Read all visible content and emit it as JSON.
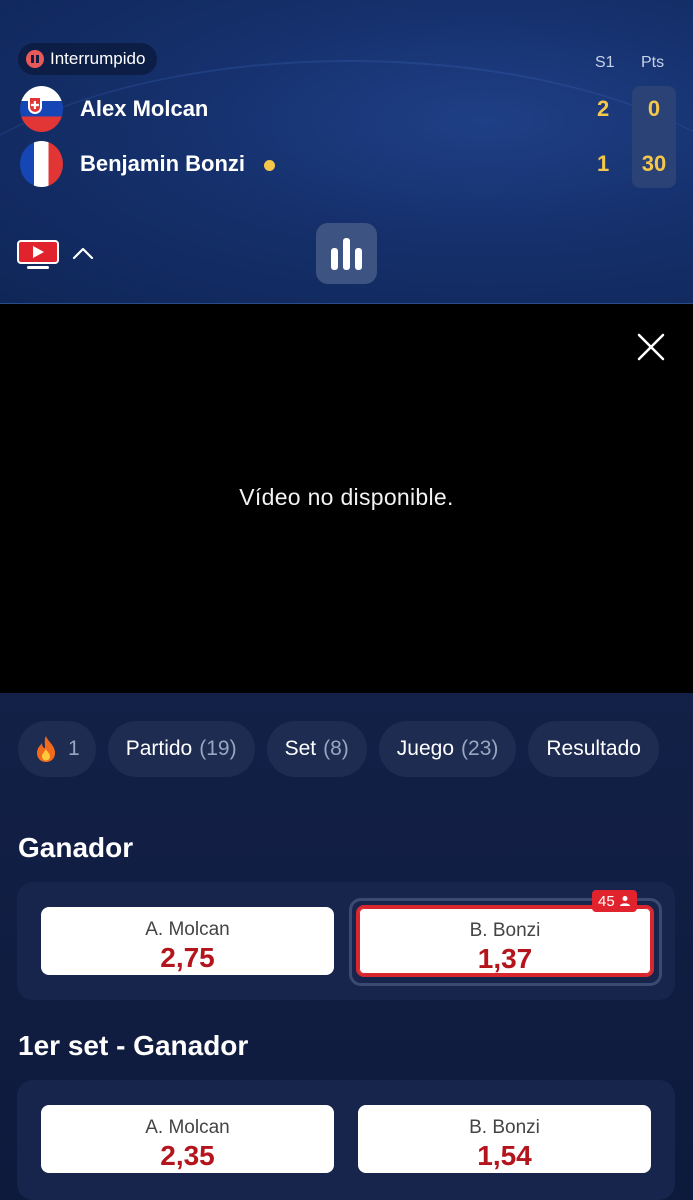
{
  "match": {
    "status": "Interrumpido",
    "columns": {
      "set1": "S1",
      "points": "Pts"
    },
    "players": [
      {
        "name": "Alex Molcan",
        "flag": "slovakia-flag",
        "set1": "2",
        "points": "0",
        "serving": false
      },
      {
        "name": "Benjamin Bonzi",
        "flag": "france-flag",
        "set1": "1",
        "points": "30",
        "serving": true
      }
    ]
  },
  "video": {
    "message": "Vídeo no disponible."
  },
  "tabs": [
    {
      "label": "",
      "count": "1",
      "icon": "flame-icon"
    },
    {
      "label": "Partido",
      "count": "(19)"
    },
    {
      "label": "Set",
      "count": "(8)"
    },
    {
      "label": "Juego",
      "count": "(23)"
    },
    {
      "label": "Resultado",
      "count": ""
    }
  ],
  "markets": [
    {
      "title": "Ganador",
      "options": [
        {
          "label": "A. Molcan",
          "odds": "2,75"
        },
        {
          "label": "B. Bonzi",
          "odds": "1,37",
          "selected": true,
          "badge": "45"
        }
      ]
    },
    {
      "title": "1er set - Ganador",
      "options": [
        {
          "label": "A. Molcan",
          "odds": "2,35"
        },
        {
          "label": "B. Bonzi",
          "odds": "1,54"
        }
      ]
    }
  ],
  "colors": {
    "header_bg": "#15306c",
    "score_yellow": "#f5c84c",
    "odds_red": "#b4141c",
    "selected_border": "#d8262e"
  }
}
